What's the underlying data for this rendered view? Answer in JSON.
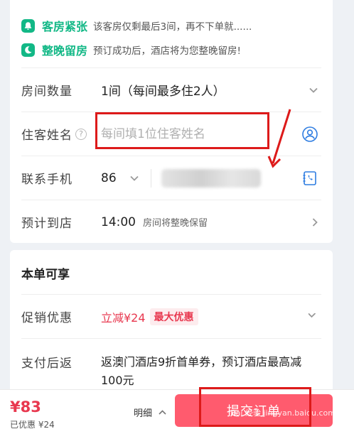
{
  "notices": [
    {
      "title": "客房紧张",
      "text": "该客房仅剩最后3间，再不下单就......",
      "icon": "bell-icon"
    },
    {
      "title": "整晚留房",
      "text": "预订成功后，酒店将为您整晚留房!",
      "icon": "moon-icon"
    }
  ],
  "rooms": {
    "label": "房间数量",
    "value": "1间（每间最多住2人）"
  },
  "guest": {
    "label": "住客姓名",
    "help": "?",
    "placeholder": "每间填1位住客姓名"
  },
  "phone": {
    "label": "联系手机",
    "code": "86"
  },
  "arrival": {
    "label": "预计到店",
    "time": "14:00",
    "note": "房间将整晚保留"
  },
  "benefits": {
    "title": "本单可享",
    "promo": {
      "label": "促销优惠",
      "value": "立减¥24",
      "tag": "最大优惠"
    },
    "cashback": {
      "label": "支付后返",
      "value": "返澳门酒店9折首单券，预订酒店最高减100元"
    }
  },
  "bottom": {
    "price": "¥83",
    "saved": "已优惠 ¥24",
    "detail": "明细",
    "submit": "提交订单",
    "watermark": "Bai 经验 jingyan.baidu.com"
  },
  "colors": {
    "accent_green": "#12b886",
    "accent_red": "#e8384f",
    "submit_bg": "#ff5b6e",
    "annotation": "#dd1a1a"
  }
}
